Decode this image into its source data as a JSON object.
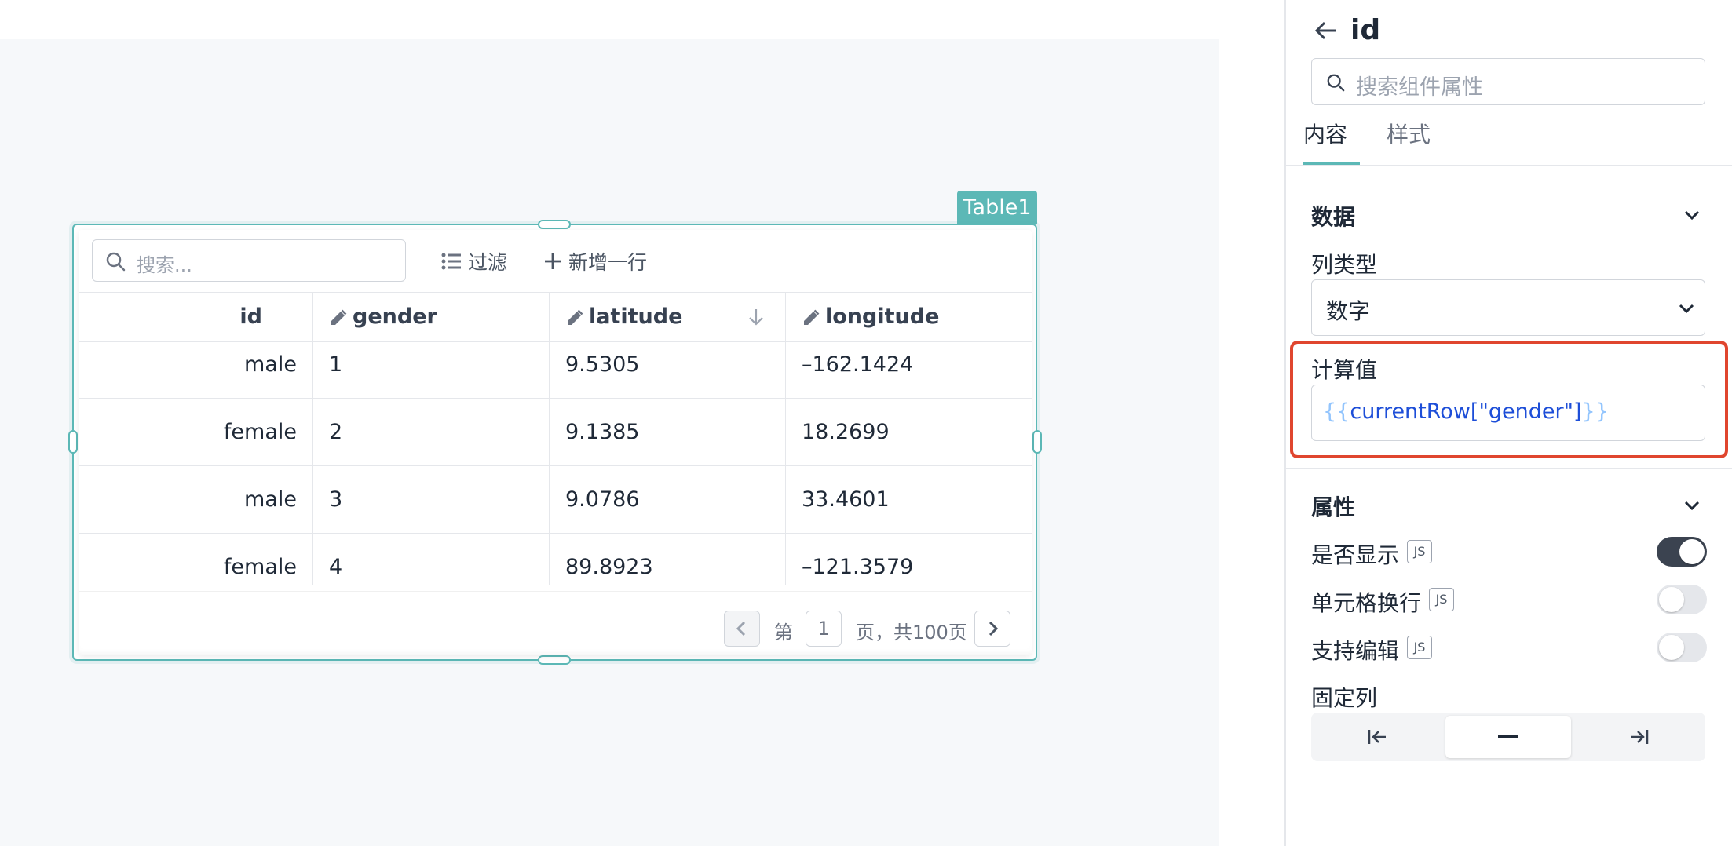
{
  "table_widget": {
    "name_tag": "Table1",
    "search_placeholder": "搜索...",
    "filter_label": "过滤",
    "add_row_label": "新增一行",
    "columns": [
      {
        "label": "id",
        "editable": false,
        "sort": ""
      },
      {
        "label": "gender",
        "editable": true,
        "sort": ""
      },
      {
        "label": "latitude",
        "editable": true,
        "sort": "descending"
      },
      {
        "label": "longitude",
        "editable": true,
        "sort": ""
      }
    ],
    "rows": [
      [
        "male",
        "1",
        "9.5305",
        "–162.1424"
      ],
      [
        "female",
        "2",
        "9.1385",
        "18.2699"
      ],
      [
        "male",
        "3",
        "9.0786",
        "33.4601"
      ],
      [
        "female",
        "4",
        "89.8923",
        "–121.3579"
      ]
    ],
    "pagination": {
      "prefix": "第",
      "current_page": "1",
      "suffix": "页，共100页"
    }
  },
  "panel": {
    "title": "id",
    "search_placeholder": "搜索组件属性",
    "tabs": [
      {
        "label": "内容",
        "active": true
      },
      {
        "label": "样式",
        "active": false
      }
    ],
    "data_section": {
      "title": "数据",
      "column_type_label": "列类型",
      "column_type_value": "数字",
      "computed_label": "计算值",
      "computed_value_prefix": "{{",
      "computed_value_body": "currentRow[\"gender\"]",
      "computed_value_suffix": "}}"
    },
    "props_section": {
      "title": "属性",
      "items": [
        {
          "label": "是否显示",
          "js": "JS",
          "on": true
        },
        {
          "label": "单元格换行",
          "js": "JS",
          "on": false
        },
        {
          "label": "支持编辑",
          "js": "JS",
          "on": false
        }
      ],
      "fixed_column_label": "固定列",
      "fixed_options": [
        "left-pin-icon",
        "none-icon",
        "right-pin-icon"
      ],
      "fixed_selected": 1
    },
    "colors": {
      "accent": "#5cb8b6",
      "highlight": "#e0462f",
      "toggle_on": "#3b4350"
    }
  }
}
